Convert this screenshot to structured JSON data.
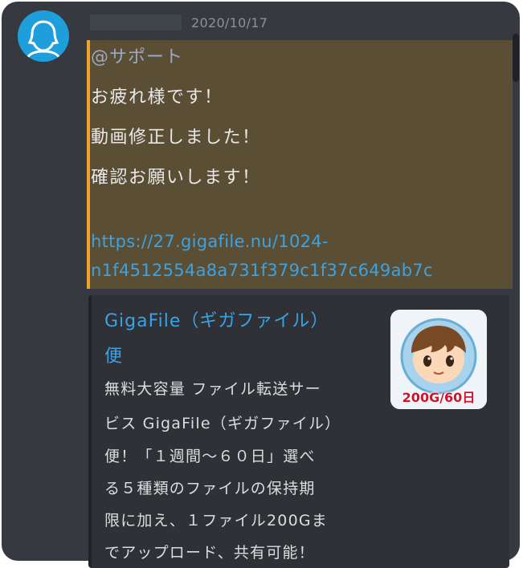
{
  "message": {
    "timestamp": "2020/10/17",
    "mention": "@サポート",
    "lines": [
      "お疲れ様です！",
      "動画修正しました！",
      "確認お願いします！"
    ],
    "link_line1": "https://27.gigafile.nu/1024-",
    "link_line2": "n1f4512554a8a731f379c1f37c649ab7c"
  },
  "embed": {
    "title_line1": "GigaFile（ギガファイル）",
    "title_line2": "便",
    "description_lines": [
      "無料大容量 ファイル転送サー",
      "ビス GigaFile（ギガファイル）",
      "便！「１週間～６０日」選べ",
      "る５種類のファイルの保持期",
      "限に加え、１ファイル200Gま",
      "でアップロード、共有可能！"
    ],
    "thumbnail_label": "200G/60日",
    "thumbnail_icon": "mascot-icon"
  },
  "colors": {
    "background": "#36393f",
    "highlight": "#5a4e35",
    "highlight_border": "#f0a32c",
    "link": "#3aa3e6",
    "avatar": "#1e9fdc"
  }
}
